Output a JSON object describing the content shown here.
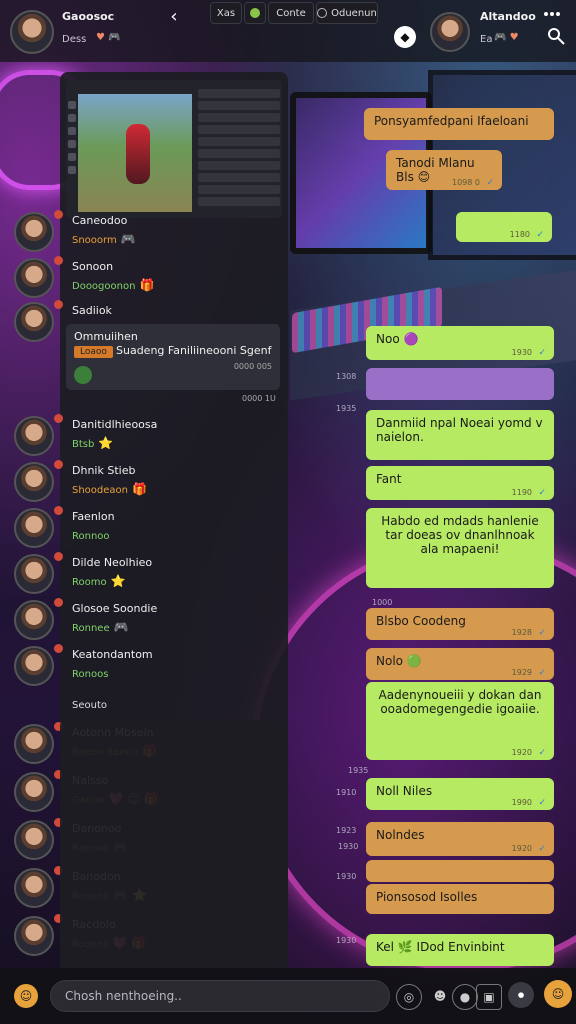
{
  "topbar": {
    "left_name": "Gaoosoc",
    "left_sub": "Dess",
    "left_emojis": "♥ 🎮",
    "back_glyph": "‹",
    "tabs": [
      {
        "label": "Xas",
        "icon": ""
      },
      {
        "label": "",
        "icon": "globe-icon"
      },
      {
        "label": "Conte",
        "icon": ""
      },
      {
        "label": "Oduenun",
        "icon": "circle-icon"
      }
    ],
    "right_name": "Altandoo",
    "right_sub": "Ea",
    "right_emojis": "🎮 ♥",
    "colors": {
      "accent": "#b6ea62",
      "orange": "#d69a4e",
      "badge": "#d24a3a"
    }
  },
  "panel": {
    "chats": [
      {
        "name": "Caneodoo",
        "msg": "Snooorm",
        "emoji": "🎮",
        "color": "orange"
      },
      {
        "name": "Sonoon",
        "msg": "Dooogoonon",
        "emoji": "🎁",
        "color": "green"
      },
      {
        "name": "Sadiiok",
        "msg": "",
        "emoji": "",
        "color": "orange"
      }
    ],
    "card": {
      "title": "Ommuiihen",
      "tag": "Loaoo",
      "text": "Suadeng Faniliineooni Sgenf",
      "time": "0000 005"
    },
    "card_footer": "0000 1U",
    "chats2": [
      {
        "name": "Danitidlhieoosa",
        "msg": "Btsb",
        "emoji": "⭐",
        "color": "green"
      },
      {
        "name": "Dhnik Stieb",
        "msg": "Shoodeaon",
        "emoji": "🎁",
        "color": "orange"
      },
      {
        "name": "Faenlon",
        "msg": "Ronnoo",
        "emoji": "",
        "color": "green"
      },
      {
        "name": "Dilde Neolhieo",
        "msg": "Roomo",
        "emoji": "⭐",
        "color": "green"
      },
      {
        "name": "Glosoe Soondie",
        "msg": "Ronnee",
        "emoji": "🎮",
        "color": "green"
      },
      {
        "name": "Keatondantom",
        "msg": "Ronoos",
        "emoji": "",
        "color": "green"
      }
    ],
    "sep_label": "Seouto",
    "chats3": [
      {
        "name": "Aotonn Mbsein",
        "msg": "Boeoo Ranno",
        "emoji": "🎁",
        "color": "orange"
      },
      {
        "name": "Nalsso",
        "msg": "Ganoo",
        "emoji": "💖 😊 🎁",
        "color": "orange"
      },
      {
        "name": "Danonoo",
        "msg": "Ranoos",
        "emoji": "🎮",
        "color": "green"
      },
      {
        "name": "Banodon",
        "msg": "Ronooo",
        "emoji": "🎮 ⭐",
        "color": "green"
      },
      {
        "name": "Racdolo",
        "msg": "Rooons",
        "emoji": "💖 🎁",
        "color": "green"
      }
    ]
  },
  "messages": [
    {
      "text": "Ponsyamfedpani Ifaeloani",
      "color": "orange",
      "time": ""
    },
    {
      "text": "Tanodi Mlanu  Bls 😊",
      "color": "orange",
      "time": "1098 0"
    },
    {
      "text": "",
      "color": "green",
      "time": "1180"
    },
    {
      "text": "Noo 🟣",
      "color": "green",
      "time": "1930"
    },
    {
      "text": "",
      "color": "purple",
      "time": ""
    },
    {
      "text": "Danmiid npal Noeai yomd  v naielon.",
      "color": "green",
      "time": ""
    },
    {
      "text": "Fant",
      "color": "green",
      "time": "1190"
    },
    {
      "text": "Habdo ed mdads hanlenie tar doeas ov dnanlhnoak ala mapaeni!",
      "color": "green",
      "time": ""
    },
    {
      "text": "Blsbo Coodeng",
      "color": "orange",
      "time": "1928"
    },
    {
      "text": "Nolo 🟢",
      "color": "orange",
      "time": "1929"
    },
    {
      "text": "Aadenynoueiii y dokan dan ooadomegengedie igoaiie.",
      "color": "green",
      "time": "1920"
    },
    {
      "text": "Noll Niles",
      "color": "green",
      "time": "1990"
    },
    {
      "text": "Nolndes",
      "color": "orange",
      "time": "1920"
    },
    {
      "text": "",
      "color": "orange",
      "time": ""
    },
    {
      "text": "Pionsosod Isolles",
      "color": "orange",
      "time": ""
    },
    {
      "text": "Kel 🌿  IDod Envinbint",
      "color": "green",
      "time": ""
    }
  ],
  "timestamps": [
    "1308",
    "1935",
    "1000",
    "1910",
    "1923",
    "1930",
    "1930",
    "1935",
    "1930"
  ],
  "bottom": {
    "placeholder": "Chosh nenthoeing.."
  }
}
